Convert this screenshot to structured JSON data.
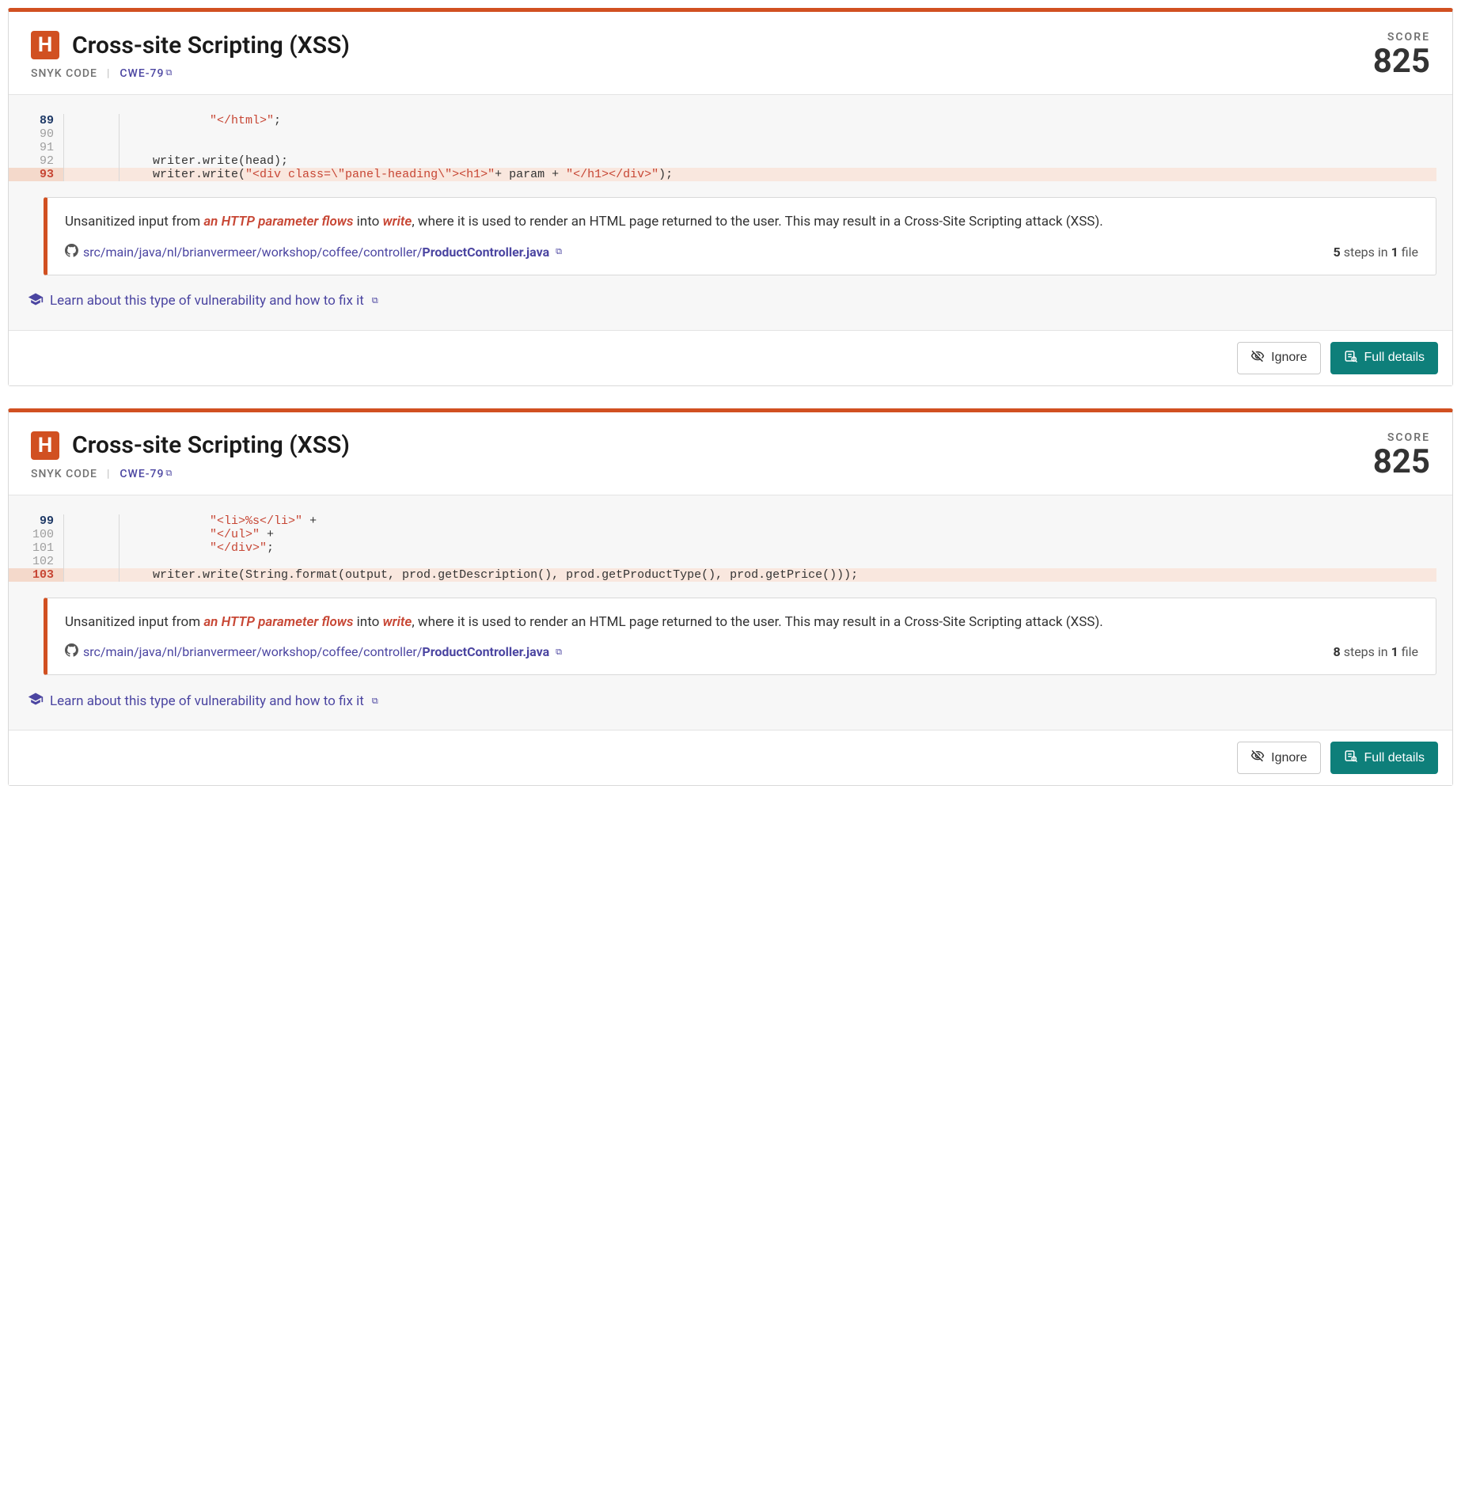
{
  "icons": {
    "severity_letter": "H"
  },
  "labels": {
    "score": "SCORE",
    "snyk_code": "SNYK CODE",
    "ignore": "Ignore",
    "full_details": "Full details",
    "learn": "Learn about this type of vulnerability and how to fix it",
    "steps_in": "steps in",
    "file_word": "file"
  },
  "cards": [
    {
      "title": "Cross-site Scripting (XSS)",
      "cwe": "CWE-79",
      "score": "825",
      "code": [
        {
          "ln": "89",
          "first": true,
          "hl": false,
          "text_pre": "            ",
          "text_str": "\"</html>\"",
          "text_post": ";"
        },
        {
          "ln": "90",
          "first": false,
          "hl": false,
          "text_pre": "",
          "text_str": "",
          "text_post": ""
        },
        {
          "ln": "91",
          "first": false,
          "hl": false,
          "text_pre": "",
          "text_str": "",
          "text_post": ""
        },
        {
          "ln": "92",
          "first": false,
          "hl": false,
          "text_pre": "    writer.write(head);",
          "text_str": "",
          "text_post": ""
        },
        {
          "ln": "93",
          "first": false,
          "hl": true,
          "text_pre": "    writer.write(",
          "text_str": "\"<div class=\\\"panel-heading\\\"><h1>\"",
          "text_mid": "+ param + ",
          "text_str2": "\"</h1></div>\"",
          "text_post": ");"
        }
      ],
      "desc_pre": "Unsanitized input from ",
      "desc_hl1": "an HTTP parameter flows",
      "desc_mid": " into ",
      "desc_hl2": "write",
      "desc_post": ", where it is used to render an HTML page returned to the user. This may result in a Cross-Site Scripting attack (XSS).",
      "file_path": "src/main/java/nl/brianvermeer/workshop/coffee/controller/",
      "file_name": "ProductController.java",
      "steps_count": "5",
      "files_count": "1"
    },
    {
      "title": "Cross-site Scripting (XSS)",
      "cwe": "CWE-79",
      "score": "825",
      "code": [
        {
          "ln": "99",
          "first": true,
          "hl": false,
          "text_pre": "            ",
          "text_str": "\"<li>%s</li>\"",
          "text_post": " +"
        },
        {
          "ln": "100",
          "first": false,
          "hl": false,
          "text_pre": "            ",
          "text_str": "\"</ul>\"",
          "text_post": " +"
        },
        {
          "ln": "101",
          "first": false,
          "hl": false,
          "text_pre": "            ",
          "text_str": "\"</div>\"",
          "text_post": ";"
        },
        {
          "ln": "102",
          "first": false,
          "hl": false,
          "text_pre": "",
          "text_str": "",
          "text_post": ""
        },
        {
          "ln": "103",
          "first": false,
          "hl": true,
          "text_pre": "    writer.write(String.format(output, prod.getDescription(), prod.getProductType(), prod.getPrice()));",
          "text_str": "",
          "text_post": ""
        }
      ],
      "desc_pre": "Unsanitized input from ",
      "desc_hl1": "an HTTP parameter flows",
      "desc_mid": " into ",
      "desc_hl2": "write",
      "desc_post": ", where it is used to render an HTML page returned to the user. This may result in a Cross-Site Scripting attack (XSS).",
      "file_path": "src/main/java/nl/brianvermeer/workshop/coffee/controller/",
      "file_name": "ProductController.java",
      "steps_count": "8",
      "files_count": "1"
    }
  ]
}
